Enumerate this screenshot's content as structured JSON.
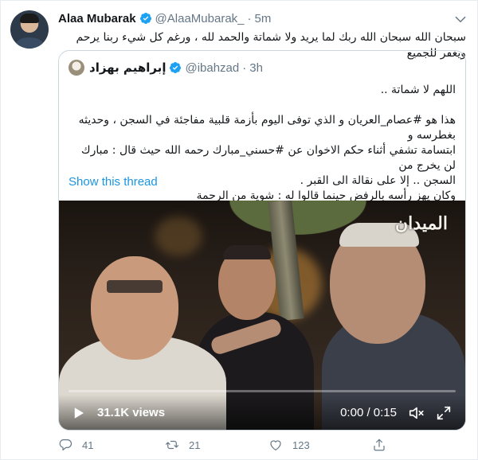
{
  "tweet": {
    "author_name": "Alaa Mubarak",
    "author_handle": "@AlaaMubarak_",
    "separator": "·",
    "time": "5m",
    "text": "سبحان الله سبحان الله ربك لما يريد ولا شماتة والحمد لله ، ورغم كل شيء ربنا يرحم ويغفر للجميع"
  },
  "quote": {
    "author_name": "إبراهيم بهزاد",
    "author_handle": "@ibahzad",
    "separator": "·",
    "time": "3h",
    "lines": [
      "اللهم لا شماتة ..",
      "",
      "هذا هو #عصام_العريان و الذي توفى اليوم بأزمة قلبية مفاجئة في السجن ، وحديثه بغطرسه و",
      "ابتسامة تشفي أثناء حكم الاخوان عن #حسني_مبارك رحمه الله حيث قال : مبارك لن يخرج من",
      "السجن .. إلا على نقالة الى القبر .",
      "وكان يهز رأسه بالرفض حينما قالوا له : شوية من الرحمة"
    ],
    "show_thread_label": "Show this thread"
  },
  "video": {
    "logo_text": "الميدان",
    "views": "31.1K views",
    "time_display": "0:00 / 0:15",
    "progress": 0.0
  },
  "actions": {
    "reply_count": "41",
    "retweet_count": "21",
    "like_count": "123"
  },
  "colors": {
    "link": "#1b95e0",
    "verified": "#1da1f2",
    "secondary_text": "#657786"
  }
}
